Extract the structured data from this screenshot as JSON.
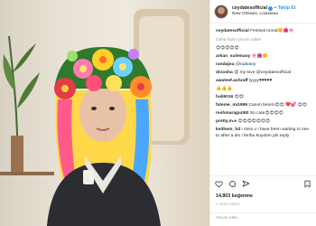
{
  "post": {
    "username": "ceydatesofficial",
    "follow_label": "Takip Et",
    "location": "New Orleans, Louisiana",
    "caption_user": "ceydatesofficial",
    "caption_text": "Festival mood🌼🌺🌸",
    "load_more": "Daha fazla yorum yükle",
    "likes": "14.803 beğenme",
    "time_ago": "1 GÜN ÖNCE",
    "comment_placeholder": "Yorum ekle..."
  },
  "comments": [
    {
      "user": "",
      "text": "😍😍😍😍😍"
    },
    {
      "user": "arkan_sulemany",
      "text": "🌸🌺🌼"
    },
    {
      "user": "randajou",
      "text": "@rudvany"
    },
    {
      "user": "drzosha",
      "text": "😍 my love @ceydatesofficial"
    },
    {
      "user": "awateef.ashraff",
      "text": "lyyyy♥♥♥♥♥"
    },
    {
      "user": "",
      "text": "👍👍👍"
    },
    {
      "user": "hali9016",
      "text": "😍😍"
    },
    {
      "user": "fateme_mi1999",
      "text": "Canım benim😍😍 ❤️💕 😍😍"
    },
    {
      "user": "reshmarajput60",
      "text": "So cute😍😍😍😍"
    },
    {
      "user": "pretty.m.e",
      "text": "😍😍😍😍😍😍😍"
    },
    {
      "user": "keithem_hd",
      "text": "i miss u i have been waiting to see to after a din i feriha koydom pls reply"
    }
  ],
  "icons": {
    "like": "heart-icon",
    "comment": "comment-icon",
    "share": "share-icon",
    "save": "bookmark-icon",
    "verified": "verified-badge-icon"
  },
  "colors": {
    "link": "#3897f0",
    "muted": "#999999",
    "text": "#262626"
  }
}
